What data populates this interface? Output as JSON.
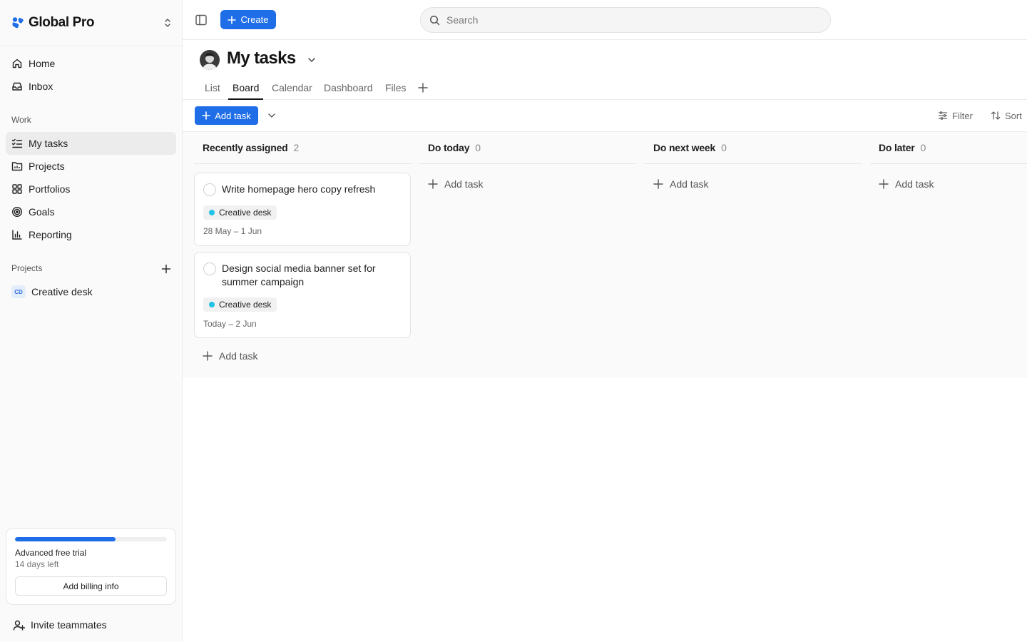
{
  "brand": {
    "name": "Global Pro"
  },
  "nav": {
    "primary": [
      {
        "label": "Home",
        "icon": "home-icon"
      },
      {
        "label": "Inbox",
        "icon": "inbox-icon"
      }
    ],
    "work_label": "Work",
    "work": [
      {
        "label": "My tasks",
        "icon": "tasks-icon",
        "active": true
      },
      {
        "label": "Projects",
        "icon": "folder-icon"
      },
      {
        "label": "Portfolios",
        "icon": "grid-icon"
      },
      {
        "label": "Goals",
        "icon": "target-icon"
      },
      {
        "label": "Reporting",
        "icon": "bar-chart-icon"
      }
    ],
    "projects_label": "Projects",
    "projects": [
      {
        "badge": "CD",
        "label": "Creative desk"
      }
    ]
  },
  "trial": {
    "progress": 0.66,
    "title": "Advanced free trial",
    "subtitle": "14 days left",
    "billing_button": "Add billing info"
  },
  "invite_label": "Invite teammates",
  "topbar": {
    "create_label": "Create",
    "search_placeholder": "Search"
  },
  "page": {
    "title": "My tasks",
    "tabs": [
      "List",
      "Board",
      "Calendar",
      "Dashboard",
      "Files"
    ],
    "active_tab": "Board"
  },
  "toolbar": {
    "add_task_label": "Add task",
    "filter_label": "Filter",
    "sort_label": "Sort"
  },
  "board": {
    "add_task_label": "Add task",
    "columns": [
      {
        "title": "Recently assigned",
        "count": "2",
        "cards": [
          {
            "title": "Write homepage hero copy refresh",
            "tag": "Creative desk",
            "date": "28 May – 1 Jun"
          },
          {
            "title": "Design social media banner set for summer campaign",
            "tag": "Creative desk",
            "date": "Today – 2 Jun"
          }
        ]
      },
      {
        "title": "Do today",
        "count": "0",
        "cards": []
      },
      {
        "title": "Do next week",
        "count": "0",
        "cards": []
      },
      {
        "title": "Do later",
        "count": "0",
        "cards": []
      }
    ]
  },
  "colors": {
    "accent": "#1f6ee8",
    "tag_dot": "#22c3e6",
    "active_nav": "#ececec"
  }
}
